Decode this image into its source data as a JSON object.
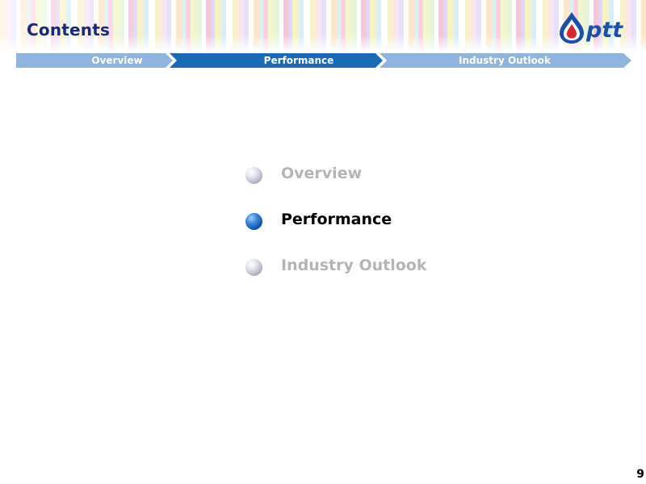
{
  "header": {
    "title": "Contents",
    "logo_text": "ptt"
  },
  "nav": {
    "items": [
      {
        "label": "Overview",
        "state": "inactive"
      },
      {
        "label": "Performance",
        "state": "active"
      },
      {
        "label": "Industry Outlook",
        "state": "inactive"
      }
    ]
  },
  "toc": {
    "items": [
      {
        "label": "Overview",
        "state": "inactive"
      },
      {
        "label": "Performance",
        "state": "active"
      },
      {
        "label": "Industry Outlook",
        "state": "inactive"
      }
    ]
  },
  "footer": {
    "page_number": "9"
  },
  "colors": {
    "title": "#1a2a7a",
    "nav_inactive": "#8fb4dd",
    "nav_active": "#1a6ab8",
    "toc_active_text": "#000000",
    "toc_inactive_text": "#b4b4b4"
  }
}
